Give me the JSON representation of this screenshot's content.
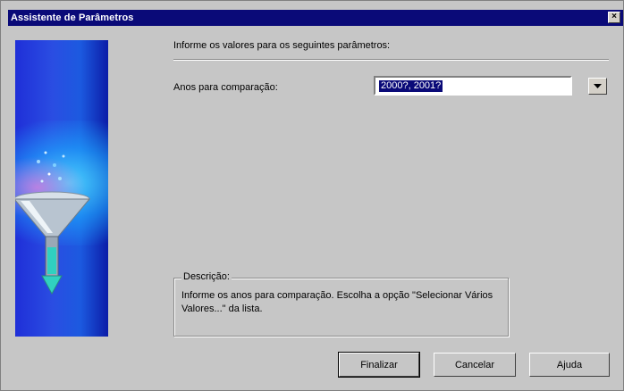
{
  "window": {
    "title": "Assistente de Parâmetros",
    "close_symbol": "×"
  },
  "main": {
    "instruction": "Informe os valores para os seguintes parâmetros:",
    "parameter": {
      "label": "Anos para comparação:",
      "value": "2000?, 2001?",
      "dropdown_icon": "chevron-down-icon"
    },
    "description": {
      "legend": "Descrição:",
      "text": "Informe os anos para comparação. Escolha a opção \"Selecionar Vários Valores...\" da lista."
    }
  },
  "buttons": {
    "finish": "Finalizar",
    "cancel": "Cancelar",
    "help": "Ajuda"
  },
  "colors": {
    "titlebar": "#0a0a78",
    "selection": "#0a0a78",
    "face": "#c6c6c6"
  }
}
